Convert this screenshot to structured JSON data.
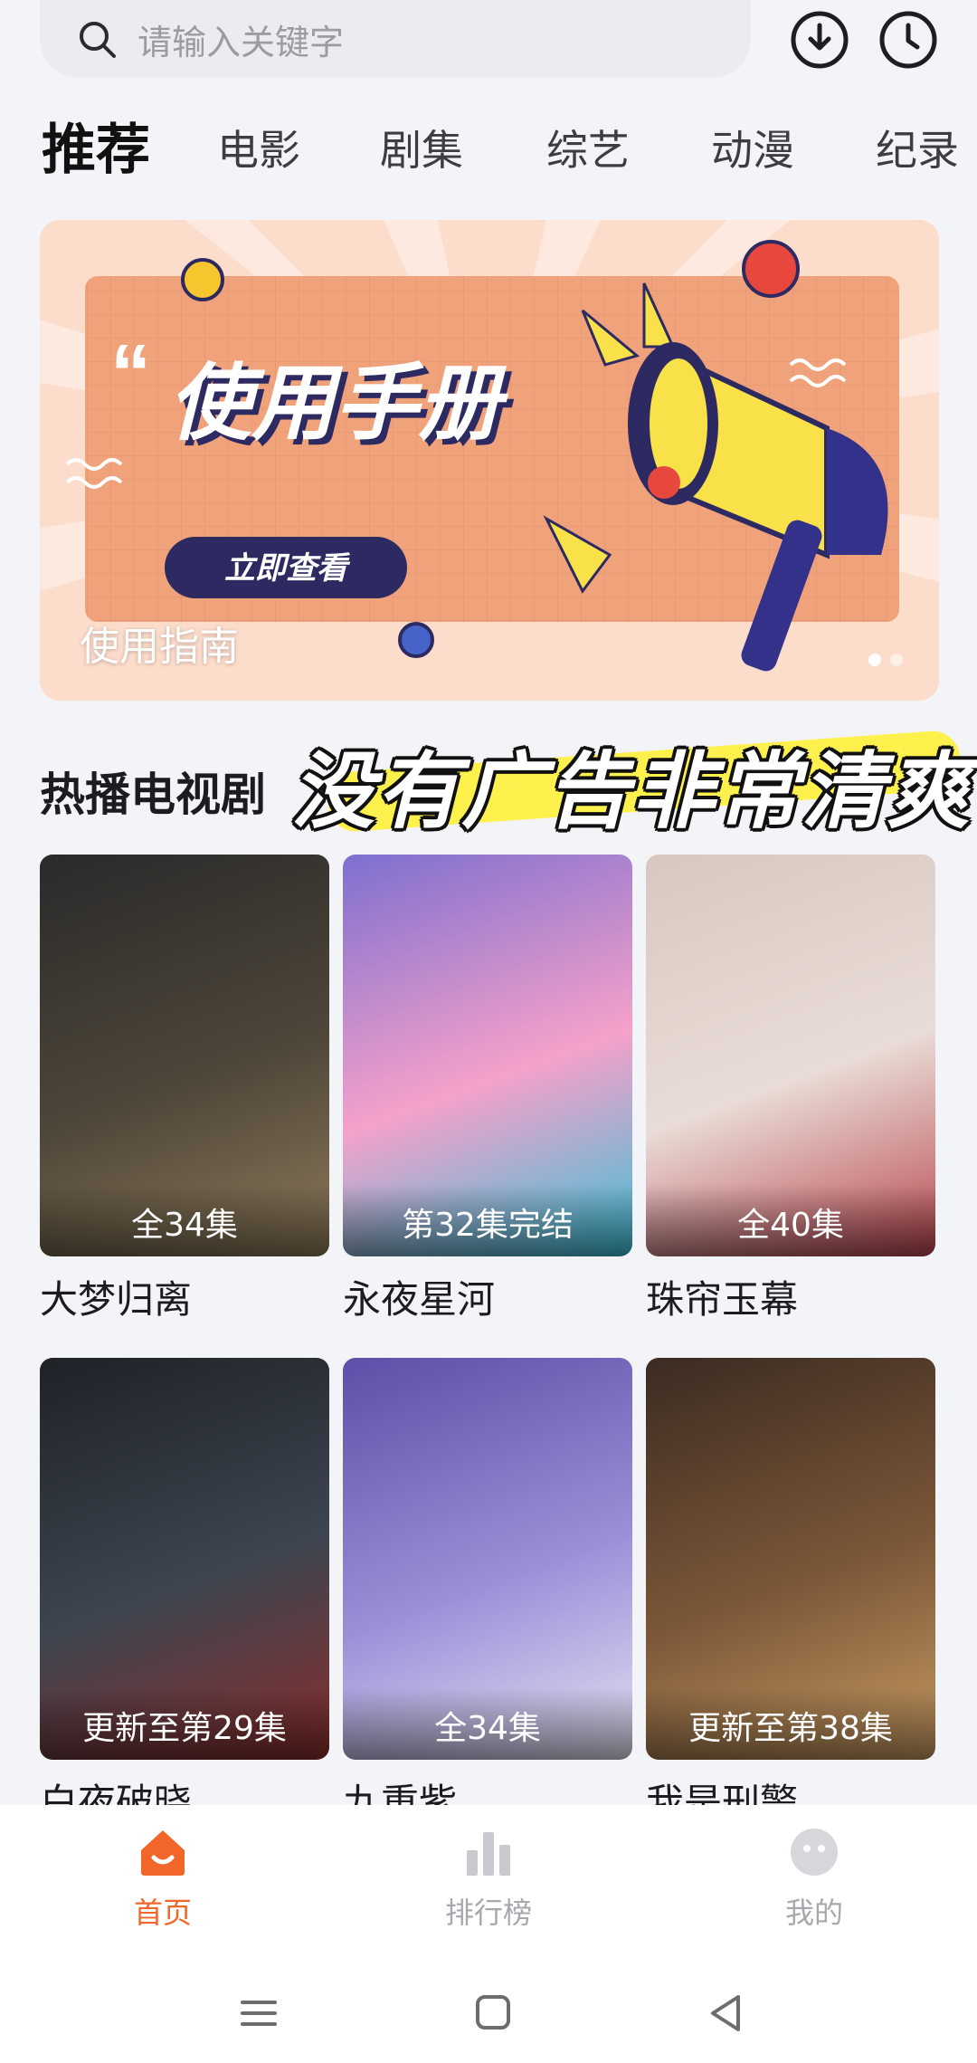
{
  "search": {
    "placeholder": "请输入关键字"
  },
  "header_icons": {
    "download": "download-icon",
    "history": "clock-icon"
  },
  "tabs": [
    {
      "label": "推荐",
      "active": true
    },
    {
      "label": "电影"
    },
    {
      "label": "剧集"
    },
    {
      "label": "综艺"
    },
    {
      "label": "动漫"
    },
    {
      "label": "纪录"
    }
  ],
  "banner": {
    "headline": "使用手册",
    "button": "立即查看",
    "caption": "使用指南",
    "dots": 2,
    "active_dot": 0
  },
  "section": {
    "title": "热播电视剧",
    "overlay": "没有广告非常清爽"
  },
  "cards": [
    {
      "title": "大梦归离",
      "badge": "全34集",
      "colors": [
        "#2a2a2a",
        "#4e4639",
        "#8d7a5a"
      ]
    },
    {
      "title": "永夜星河",
      "badge": "第32集完结",
      "colors": [
        "#7d6fd0",
        "#f5a1c9",
        "#3cc0d8"
      ]
    },
    {
      "title": "珠帘玉幕",
      "badge": "全40集",
      "colors": [
        "#d8c7c0",
        "#e9dcd6",
        "#b9474f"
      ]
    },
    {
      "title": "白夜破晓",
      "badge": "更新至第29集",
      "colors": [
        "#1f2227",
        "#3d4550",
        "#8a2e2c"
      ]
    },
    {
      "title": "九重紫",
      "badge": "全34集",
      "colors": [
        "#5b4fa8",
        "#9c8fd8",
        "#e6e1f3"
      ]
    },
    {
      "title": "我是刑警",
      "badge": "更新至第38集",
      "colors": [
        "#3b2b22",
        "#7b5738",
        "#c89a62"
      ]
    }
  ],
  "bottom_nav": [
    {
      "label": "首页",
      "icon": "home-icon",
      "active": true
    },
    {
      "label": "排行榜",
      "icon": "ranking-icon"
    },
    {
      "label": "我的",
      "icon": "profile-icon"
    }
  ],
  "colors": {
    "accent": "#f2662a",
    "background": "#f3f4f8"
  }
}
